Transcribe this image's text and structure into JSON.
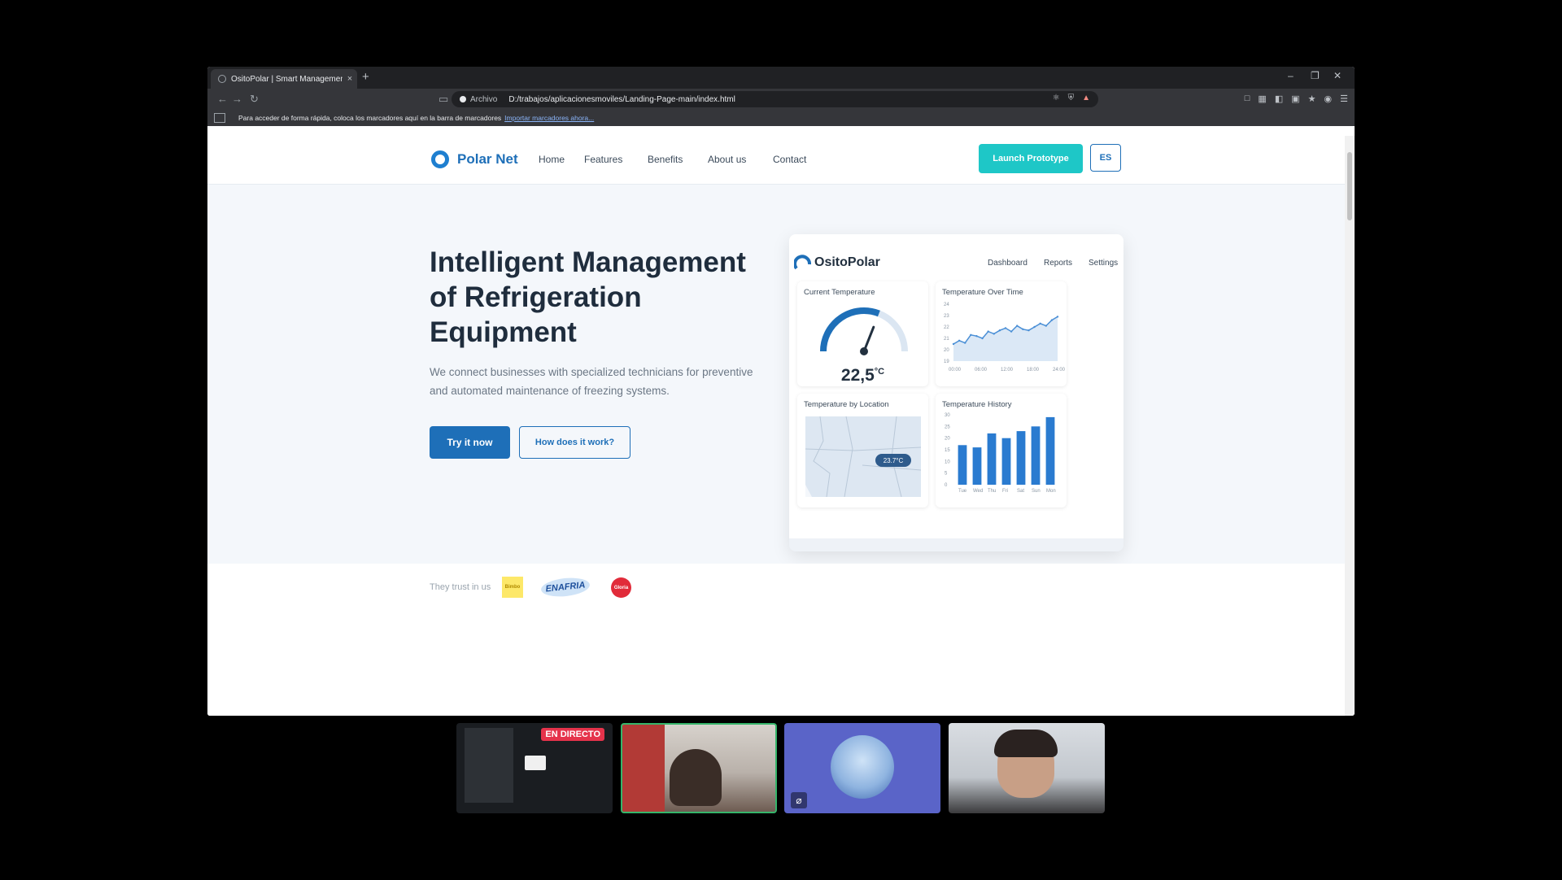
{
  "browser": {
    "tab_title": "OsitoPolar | Smart Managemen…",
    "tab_close": "×",
    "new_tab": "+",
    "win_minimize": "–",
    "win_restore": "❐",
    "win_close": "✕",
    "site_info": "Archivo",
    "url": "D:/trabajos/aplicacionesmoviles/Landing-Page-main/index.html",
    "bookmark_hint": "Para acceder de forma rápida, coloca los marcadores aquí en la barra de marcadores",
    "bookmark_import": "Importar marcadores ahora..."
  },
  "site": {
    "brand": "Polar Net",
    "nav": [
      "Home",
      "Features",
      "Benefits",
      "About us",
      "Contact"
    ],
    "launch_button": "Launch Prototype",
    "lang_button": "ES"
  },
  "hero": {
    "title": "Intelligent Management of Refrigeration Equipment",
    "description": "We connect businesses with specialized technicians for preventive and automated maintenance of freezing systems.",
    "primary_button": "Try it now",
    "secondary_button": "How does it work?"
  },
  "dashboard": {
    "brand": "OsitoPolar",
    "nav": [
      "Dashboard",
      "Reports",
      "Settings"
    ],
    "current_temp_title": "Current Temperature",
    "current_temp_value": "22,5",
    "current_temp_unit": "°C",
    "gauge_fraction": 0.62,
    "temp_over_time_title": "Temperature Over Time",
    "temp_by_location_title": "Temperature by Location",
    "location_pin": "23.7°C",
    "temp_history_title": "Temperature History"
  },
  "chart_data": [
    {
      "type": "area",
      "title": "Temperature Over Time",
      "x": [
        "00:00",
        "06:00",
        "12:00",
        "18:00",
        "24:00"
      ],
      "values": [
        20.5,
        20.8,
        20.6,
        21.3,
        21.2,
        21.0,
        21.6,
        21.4,
        21.7,
        21.9,
        21.6,
        22.1,
        21.8,
        21.7,
        22.0,
        22.3,
        22.1,
        22.6,
        22.9
      ],
      "yticks": [
        "19",
        "20",
        "21",
        "22",
        "23",
        "24"
      ],
      "ylim": [
        19,
        24
      ]
    },
    {
      "type": "bar",
      "title": "Temperature History",
      "categories": [
        "Tue",
        "Wed",
        "Thu",
        "Fri",
        "Sat",
        "Sun",
        "Mon"
      ],
      "values": [
        17,
        16,
        22,
        20,
        23,
        25,
        29
      ],
      "yticks": [
        "0",
        "5",
        "10",
        "15",
        "20",
        "25",
        "30"
      ],
      "ylim": [
        0,
        30
      ]
    }
  ],
  "trust": {
    "label": "They trust in us",
    "logo_a": "Bimbo",
    "logo_b": "ENAFRIA",
    "logo_c": "Gloria"
  },
  "call": {
    "live_badge": "EN DIRECTO",
    "mute_icon": "⌀"
  },
  "colors": {
    "primary": "#1e6fb8",
    "accent": "#1ec7c7",
    "live": "#e5334b"
  }
}
